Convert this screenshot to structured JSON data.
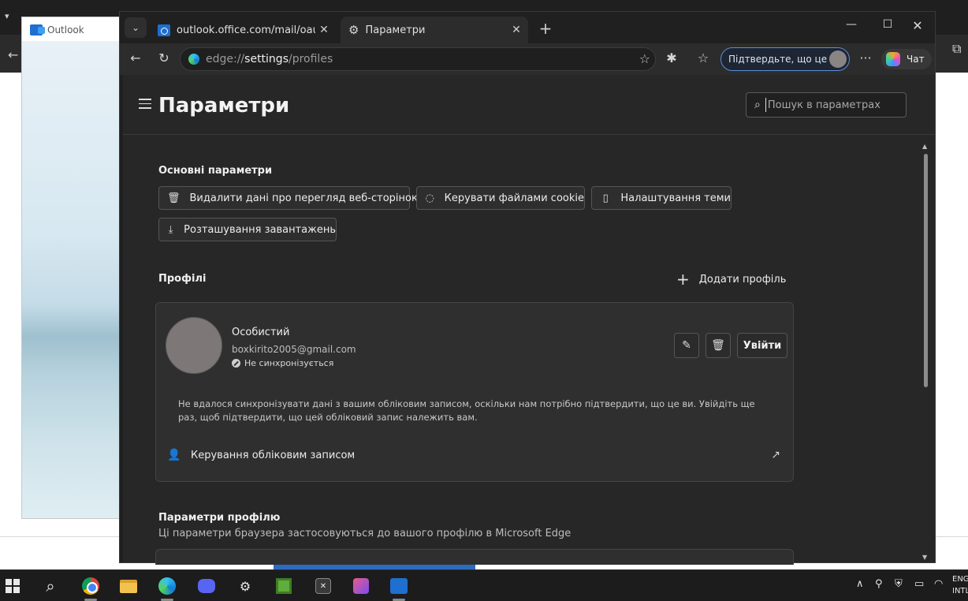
{
  "background": {
    "outlook_window_title": "Outlook"
  },
  "browser": {
    "tabs": [
      {
        "title": "outlook.office.com/mail/oauthRedirect",
        "close": "✕"
      },
      {
        "title": "Параметри",
        "close": "✕"
      }
    ],
    "new_tab": "+",
    "address": {
      "prefix": "edge://",
      "main": "settings",
      "suffix": "/profiles"
    },
    "verify_pill": "Підтвердьте, що це ви",
    "copilot_label": "Чат"
  },
  "settings": {
    "title": "Параметри",
    "search_placeholder": "Пошук в параметрах",
    "basic_section": {
      "title": "Основні параметри",
      "chips": [
        "Видалити дані про перегляд веб-сторінок",
        "Керувати файлами cookie",
        "Налаштування теми",
        "Розташування завантажень"
      ]
    },
    "profiles_section": {
      "title": "Профілі",
      "add_profile": "Додати профіль",
      "profile": {
        "name": "Особистий",
        "email": "boxkirito2005@gmail.com",
        "sync_status": "Не синхронізується",
        "sign_in_label": "Увійти",
        "sync_message": "Не вдалося синхронізувати дані з вашим обліковим записом, оскільки нам потрібно підтвердити, що це ви. Увійдіть ще раз, щоб підтвердити, що цей обліковий запис належить вам.",
        "manage_label": "Керування обліковим записом"
      }
    },
    "profile_settings_section": {
      "title": "Параметри профілю",
      "subtitle": "Ці параметри браузера застосовуються до вашого профілю в Microsoft Edge"
    }
  },
  "taskbar": {
    "lang_line1": "ENG",
    "lang_line2": "INTL"
  },
  "colors": {
    "accent_blue": "#5a8fd6",
    "page_bg": "#272727",
    "card_bg": "#2f2f2f"
  }
}
